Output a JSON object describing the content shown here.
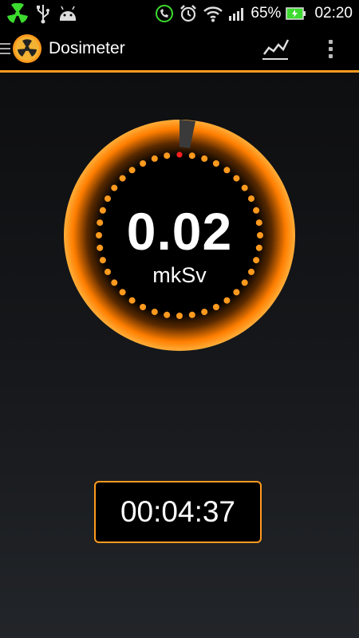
{
  "status_bar": {
    "icons_left": [
      "radiation-icon",
      "usb-icon",
      "android-icon"
    ],
    "icons_right": [
      "phone-icon",
      "alarm-icon",
      "wifi-icon",
      "signal-icon",
      "battery-icon"
    ],
    "battery": "65%",
    "time": "02:20"
  },
  "app_bar": {
    "title": "Dosimeter",
    "icons": [
      "menu-icon",
      "app-logo-icon",
      "chart-icon",
      "overflow-menu-icon"
    ]
  },
  "gauge": {
    "value": "0.02",
    "unit": "mkSv",
    "colors": {
      "ring": "#ff8a00",
      "dots": "#ff9a1e",
      "active_dot": "#ff2020"
    }
  },
  "timer": {
    "value": "00:04:37"
  }
}
